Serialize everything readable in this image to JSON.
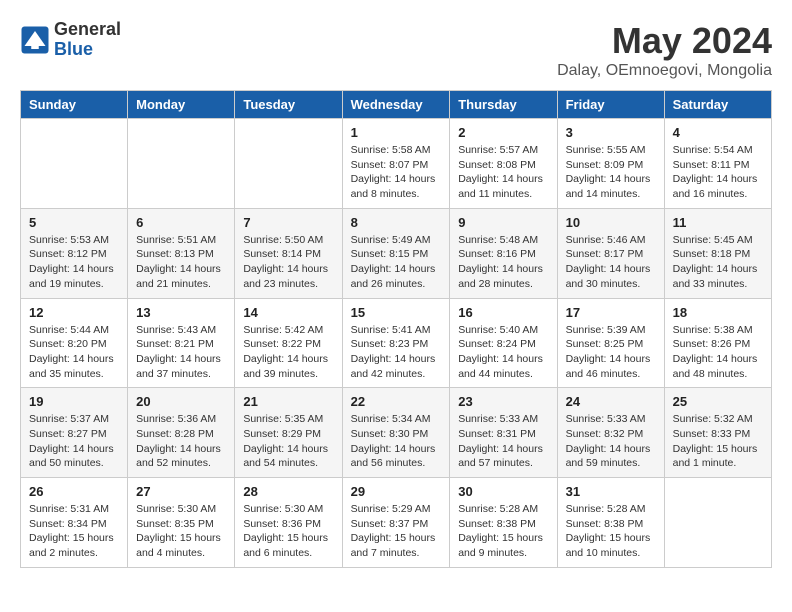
{
  "logo": {
    "general": "General",
    "blue": "Blue"
  },
  "title": "May 2024",
  "subtitle": "Dalay, OEmnoegovi, Mongolia",
  "days_header": [
    "Sunday",
    "Monday",
    "Tuesday",
    "Wednesday",
    "Thursday",
    "Friday",
    "Saturday"
  ],
  "weeks": [
    [
      {
        "day": "",
        "info": ""
      },
      {
        "day": "",
        "info": ""
      },
      {
        "day": "",
        "info": ""
      },
      {
        "day": "1",
        "info": "Sunrise: 5:58 AM\nSunset: 8:07 PM\nDaylight: 14 hours\nand 8 minutes."
      },
      {
        "day": "2",
        "info": "Sunrise: 5:57 AM\nSunset: 8:08 PM\nDaylight: 14 hours\nand 11 minutes."
      },
      {
        "day": "3",
        "info": "Sunrise: 5:55 AM\nSunset: 8:09 PM\nDaylight: 14 hours\nand 14 minutes."
      },
      {
        "day": "4",
        "info": "Sunrise: 5:54 AM\nSunset: 8:11 PM\nDaylight: 14 hours\nand 16 minutes."
      }
    ],
    [
      {
        "day": "5",
        "info": "Sunrise: 5:53 AM\nSunset: 8:12 PM\nDaylight: 14 hours\nand 19 minutes."
      },
      {
        "day": "6",
        "info": "Sunrise: 5:51 AM\nSunset: 8:13 PM\nDaylight: 14 hours\nand 21 minutes."
      },
      {
        "day": "7",
        "info": "Sunrise: 5:50 AM\nSunset: 8:14 PM\nDaylight: 14 hours\nand 23 minutes."
      },
      {
        "day": "8",
        "info": "Sunrise: 5:49 AM\nSunset: 8:15 PM\nDaylight: 14 hours\nand 26 minutes."
      },
      {
        "day": "9",
        "info": "Sunrise: 5:48 AM\nSunset: 8:16 PM\nDaylight: 14 hours\nand 28 minutes."
      },
      {
        "day": "10",
        "info": "Sunrise: 5:46 AM\nSunset: 8:17 PM\nDaylight: 14 hours\nand 30 minutes."
      },
      {
        "day": "11",
        "info": "Sunrise: 5:45 AM\nSunset: 8:18 PM\nDaylight: 14 hours\nand 33 minutes."
      }
    ],
    [
      {
        "day": "12",
        "info": "Sunrise: 5:44 AM\nSunset: 8:20 PM\nDaylight: 14 hours\nand 35 minutes."
      },
      {
        "day": "13",
        "info": "Sunrise: 5:43 AM\nSunset: 8:21 PM\nDaylight: 14 hours\nand 37 minutes."
      },
      {
        "day": "14",
        "info": "Sunrise: 5:42 AM\nSunset: 8:22 PM\nDaylight: 14 hours\nand 39 minutes."
      },
      {
        "day": "15",
        "info": "Sunrise: 5:41 AM\nSunset: 8:23 PM\nDaylight: 14 hours\nand 42 minutes."
      },
      {
        "day": "16",
        "info": "Sunrise: 5:40 AM\nSunset: 8:24 PM\nDaylight: 14 hours\nand 44 minutes."
      },
      {
        "day": "17",
        "info": "Sunrise: 5:39 AM\nSunset: 8:25 PM\nDaylight: 14 hours\nand 46 minutes."
      },
      {
        "day": "18",
        "info": "Sunrise: 5:38 AM\nSunset: 8:26 PM\nDaylight: 14 hours\nand 48 minutes."
      }
    ],
    [
      {
        "day": "19",
        "info": "Sunrise: 5:37 AM\nSunset: 8:27 PM\nDaylight: 14 hours\nand 50 minutes."
      },
      {
        "day": "20",
        "info": "Sunrise: 5:36 AM\nSunset: 8:28 PM\nDaylight: 14 hours\nand 52 minutes."
      },
      {
        "day": "21",
        "info": "Sunrise: 5:35 AM\nSunset: 8:29 PM\nDaylight: 14 hours\nand 54 minutes."
      },
      {
        "day": "22",
        "info": "Sunrise: 5:34 AM\nSunset: 8:30 PM\nDaylight: 14 hours\nand 56 minutes."
      },
      {
        "day": "23",
        "info": "Sunrise: 5:33 AM\nSunset: 8:31 PM\nDaylight: 14 hours\nand 57 minutes."
      },
      {
        "day": "24",
        "info": "Sunrise: 5:33 AM\nSunset: 8:32 PM\nDaylight: 14 hours\nand 59 minutes."
      },
      {
        "day": "25",
        "info": "Sunrise: 5:32 AM\nSunset: 8:33 PM\nDaylight: 15 hours\nand 1 minute."
      }
    ],
    [
      {
        "day": "26",
        "info": "Sunrise: 5:31 AM\nSunset: 8:34 PM\nDaylight: 15 hours\nand 2 minutes."
      },
      {
        "day": "27",
        "info": "Sunrise: 5:30 AM\nSunset: 8:35 PM\nDaylight: 15 hours\nand 4 minutes."
      },
      {
        "day": "28",
        "info": "Sunrise: 5:30 AM\nSunset: 8:36 PM\nDaylight: 15 hours\nand 6 minutes."
      },
      {
        "day": "29",
        "info": "Sunrise: 5:29 AM\nSunset: 8:37 PM\nDaylight: 15 hours\nand 7 minutes."
      },
      {
        "day": "30",
        "info": "Sunrise: 5:28 AM\nSunset: 8:38 PM\nDaylight: 15 hours\nand 9 minutes."
      },
      {
        "day": "31",
        "info": "Sunrise: 5:28 AM\nSunset: 8:38 PM\nDaylight: 15 hours\nand 10 minutes."
      },
      {
        "day": "",
        "info": ""
      }
    ]
  ]
}
